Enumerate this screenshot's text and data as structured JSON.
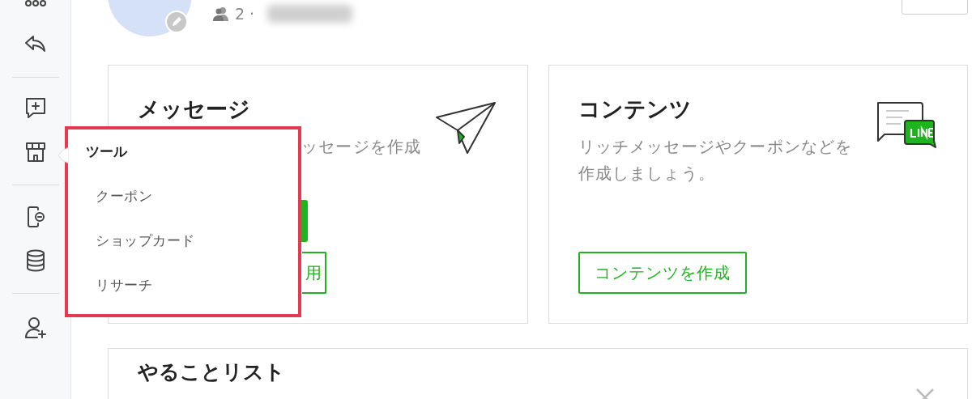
{
  "profile": {
    "member_count": "2",
    "separator": "·"
  },
  "cards": [
    {
      "kind": "message",
      "title": "メッセージ",
      "description": "ッセージを作成",
      "button": "用"
    },
    {
      "kind": "content",
      "title": "コンテンツ",
      "description": "リッチメッセージやクーポンなどを作成しましょう。",
      "button": "コンテンツを作成"
    }
  ],
  "todo": {
    "title": "やることリスト"
  },
  "tool_menu": {
    "title": "ツール",
    "items": [
      "クーポン",
      "ショップカード",
      "リサーチ"
    ]
  }
}
